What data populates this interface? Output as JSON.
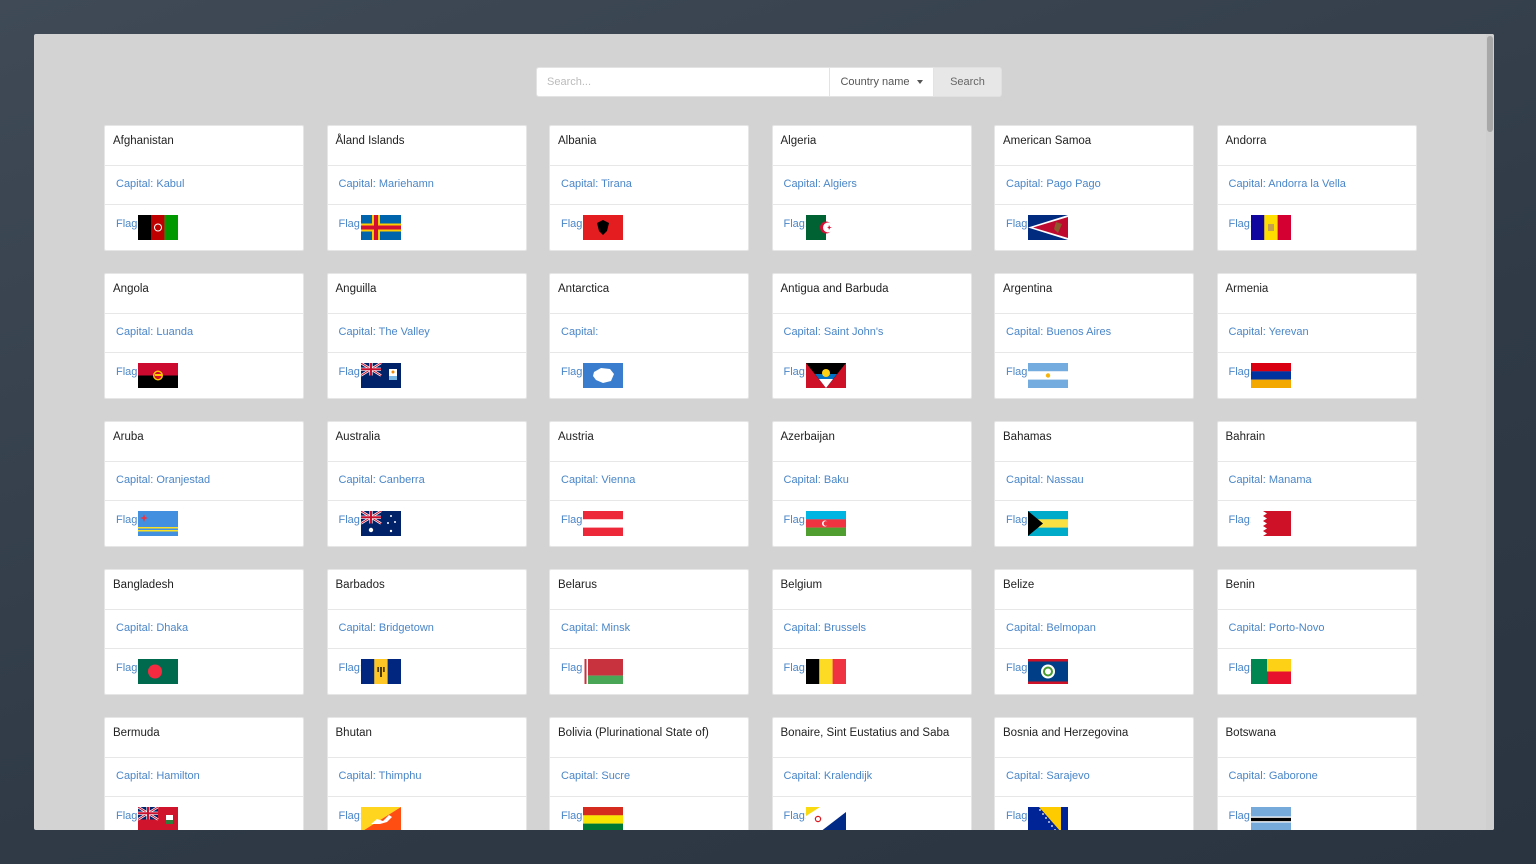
{
  "search": {
    "placeholder": "Search...",
    "value": "",
    "filter": "Country name",
    "button": "Search"
  },
  "flag_label": "Flag:",
  "countries": [
    {
      "name": "Afghanistan",
      "capital": "Capital: Kabul",
      "flag": "afghanistan-flag"
    },
    {
      "name": "Åland Islands",
      "capital": "Capital: Mariehamn",
      "flag": "aland-flag"
    },
    {
      "name": "Albania",
      "capital": "Capital: Tirana",
      "flag": "albania-flag"
    },
    {
      "name": "Algeria",
      "capital": "Capital: Algiers",
      "flag": "algeria-flag"
    },
    {
      "name": "American Samoa",
      "capital": "Capital: Pago Pago",
      "flag": "american-samoa-flag"
    },
    {
      "name": "Andorra",
      "capital": "Capital: Andorra la Vella",
      "flag": "andorra-flag"
    },
    {
      "name": "Angola",
      "capital": "Capital: Luanda",
      "flag": "angola-flag"
    },
    {
      "name": "Anguilla",
      "capital": "Capital: The Valley",
      "flag": "anguilla-flag"
    },
    {
      "name": "Antarctica",
      "capital": "Capital:",
      "flag": "antarctica-flag"
    },
    {
      "name": "Antigua and Barbuda",
      "capital": "Capital: Saint John's",
      "flag": "antigua-flag"
    },
    {
      "name": "Argentina",
      "capital": "Capital: Buenos Aires",
      "flag": "argentina-flag"
    },
    {
      "name": "Armenia",
      "capital": "Capital: Yerevan",
      "flag": "armenia-flag"
    },
    {
      "name": "Aruba",
      "capital": "Capital: Oranjestad",
      "flag": "aruba-flag"
    },
    {
      "name": "Australia",
      "capital": "Capital: Canberra",
      "flag": "australia-flag"
    },
    {
      "name": "Austria",
      "capital": "Capital: Vienna",
      "flag": "austria-flag"
    },
    {
      "name": "Azerbaijan",
      "capital": "Capital: Baku",
      "flag": "azerbaijan-flag"
    },
    {
      "name": "Bahamas",
      "capital": "Capital: Nassau",
      "flag": "bahamas-flag"
    },
    {
      "name": "Bahrain",
      "capital": "Capital: Manama",
      "flag": "bahrain-flag"
    },
    {
      "name": "Bangladesh",
      "capital": "Capital: Dhaka",
      "flag": "bangladesh-flag"
    },
    {
      "name": "Barbados",
      "capital": "Capital: Bridgetown",
      "flag": "barbados-flag"
    },
    {
      "name": "Belarus",
      "capital": "Capital: Minsk",
      "flag": "belarus-flag"
    },
    {
      "name": "Belgium",
      "capital": "Capital: Brussels",
      "flag": "belgium-flag"
    },
    {
      "name": "Belize",
      "capital": "Capital: Belmopan",
      "flag": "belize-flag"
    },
    {
      "name": "Benin",
      "capital": "Capital: Porto-Novo",
      "flag": "benin-flag"
    },
    {
      "name": "Bermuda",
      "capital": "Capital: Hamilton",
      "flag": "bermuda-flag"
    },
    {
      "name": "Bhutan",
      "capital": "Capital: Thimphu",
      "flag": "bhutan-flag"
    },
    {
      "name": "Bolivia (Plurinational State of)",
      "capital": "Capital: Sucre",
      "flag": "bolivia-flag"
    },
    {
      "name": "Bonaire, Sint Eustatius and Saba",
      "capital": "Capital: Kralendijk",
      "flag": "bonaire-flag"
    },
    {
      "name": "Bosnia and Herzegovina",
      "capital": "Capital: Sarajevo",
      "flag": "bosnia-flag"
    },
    {
      "name": "Botswana",
      "capital": "Capital: Gaborone",
      "flag": "botswana-flag"
    }
  ]
}
